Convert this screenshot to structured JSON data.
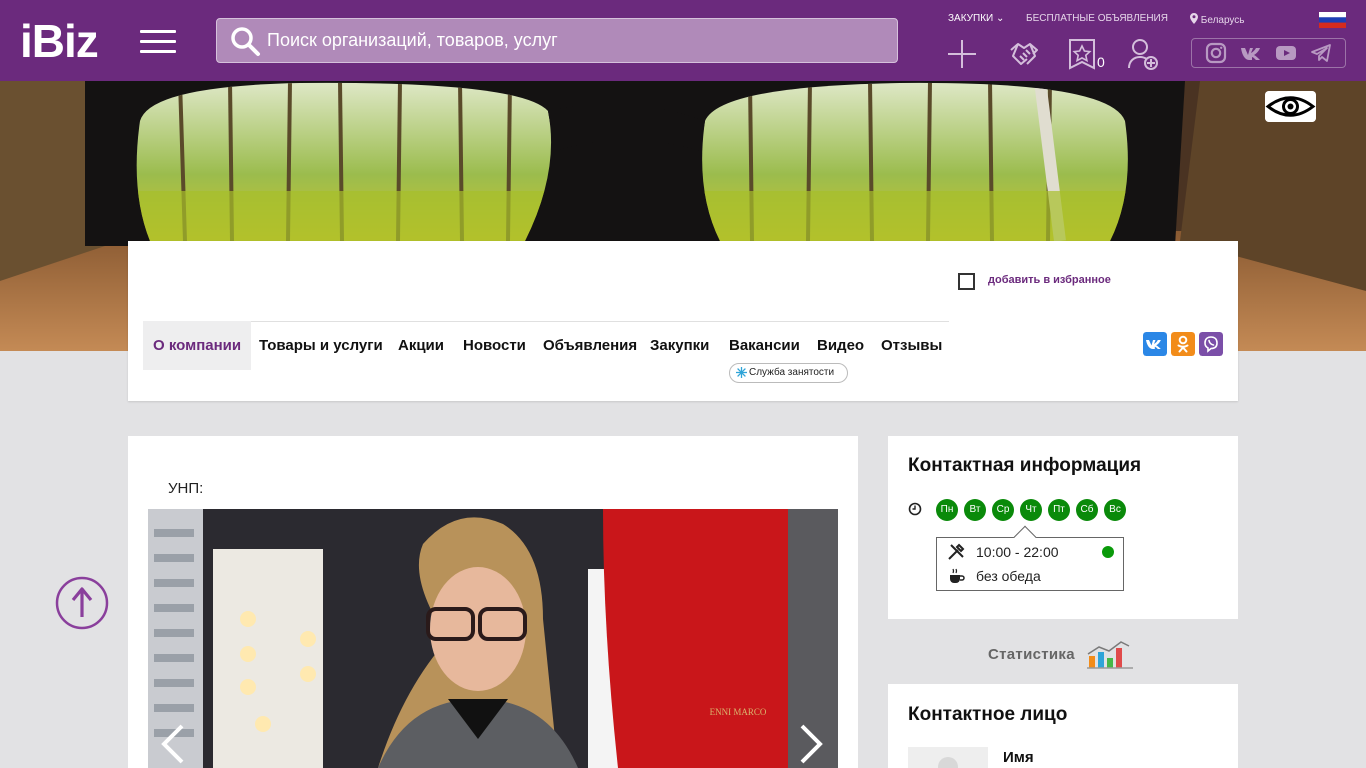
{
  "header": {
    "logo": "iBiz",
    "search_placeholder": "Поиск организаций, товаров, услуг",
    "link_purchases": "ЗАКУПКИ",
    "link_free_ads": "БЕСПЛАТНЫЕ ОБЪЯВЛЕНИЯ",
    "region": "Беларусь",
    "favorites_count": "0"
  },
  "company": {
    "add_to_favorites": "добавить в избранное",
    "tabs": [
      "О компании",
      "Товары и услуги",
      "Акции",
      "Новости",
      "Объявления",
      "Закупки",
      "Вакансии",
      "Видео",
      "Отзывы"
    ],
    "employment_badge": "Служба занятости"
  },
  "main": {
    "unp_label": "УНП:",
    "photo_brand": "ENNI MARCO"
  },
  "contact": {
    "title": "Контактная информация",
    "days": [
      "Пн",
      "Вт",
      "Ср",
      "Чт",
      "Пт",
      "Сб",
      "Вс"
    ],
    "hours": "10:00 - 22:00",
    "break": "без обеда"
  },
  "stats_label": "Статистика",
  "person": {
    "title": "Контактное лицо",
    "name_label": "Имя"
  },
  "colors": {
    "brand": "#6b2a7d",
    "day_green": "#0a8a0a"
  }
}
